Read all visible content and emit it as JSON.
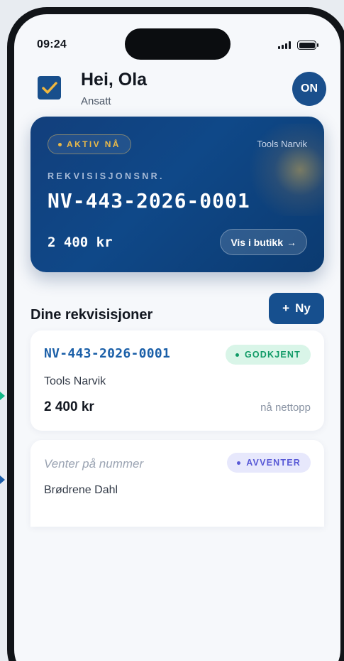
{
  "status_bar": {
    "time": "09:24"
  },
  "header": {
    "greeting": "Hei, Ola",
    "role": "Ansatt",
    "avatar_initials": "ON"
  },
  "active_card": {
    "status_label": "AKTIV NÅ",
    "store": "Tools Narvik",
    "number_label": "REKVISISJONSNR.",
    "number": "NV-443-2026-0001",
    "amount": "2 400 kr",
    "button_label": "Vis i butikk",
    "button_arrow": "→"
  },
  "list": {
    "title": "Dine rekvisisjoner",
    "new_button_plus": "+",
    "new_button_label": "Ny",
    "items": [
      {
        "number": "NV-443-2026-0001",
        "status": "GODKJENT",
        "store": "Tools Narvik",
        "amount": "2 400 kr",
        "time": "nå nettopp"
      },
      {
        "number": "Venter på nummer",
        "status": "AVVENTER",
        "store": "Brødrene Dahl"
      }
    ]
  },
  "colors": {
    "brand_blue": "#164f8e",
    "accent_gold": "#e9b949",
    "approved_green": "#109a66",
    "pending_purple": "#5859d6"
  }
}
